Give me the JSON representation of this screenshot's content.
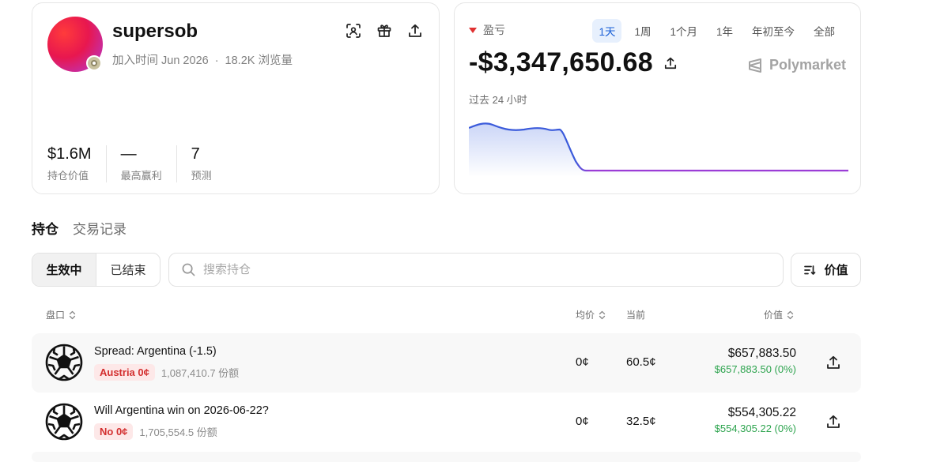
{
  "profile": {
    "username": "supersob",
    "joined": "加入时间 Jun 2026",
    "views": "18.2K 浏览量",
    "stats": [
      {
        "value": "$1.6M",
        "label": "持仓价值"
      },
      {
        "value": "—",
        "label": "最高赢利"
      },
      {
        "value": "7",
        "label": "预测"
      }
    ]
  },
  "pnl": {
    "label": "盈亏",
    "ranges": [
      "1天",
      "1周",
      "1个月",
      "1年",
      "年初至今",
      "全部"
    ],
    "active_range": "1天",
    "value": "-$3,347,650.68",
    "brand": "Polymarket",
    "period": "过去 24 小时",
    "colors": {
      "line_start": "#3b5bdb",
      "line_end": "#9b3dd6",
      "down": "#e03131"
    }
  },
  "tabs": [
    "持仓",
    "交易记录"
  ],
  "filter": {
    "active": "生效中",
    "inactive": "已结束"
  },
  "search": {
    "placeholder": "搜索持仓"
  },
  "sort": {
    "label": "价值"
  },
  "table": {
    "headers": {
      "market": "盘口",
      "avg": "均价",
      "current": "当前",
      "value": "价值"
    },
    "rows": [
      {
        "title": "Spread: Argentina (-1.5)",
        "outcome": "Austria 0¢",
        "shares": "1,087,410.7 份额",
        "avg": "0¢",
        "current": "60.5¢",
        "value": "$657,883.50",
        "change": "$657,883.50 (0%)"
      },
      {
        "title": "Will Argentina win on 2026-06-22?",
        "outcome": "No 0¢",
        "shares": "1,705,554.5 份额",
        "avg": "0¢",
        "current": "32.5¢",
        "value": "$554,305.22",
        "change": "$554,305.22 (0%)"
      }
    ]
  }
}
